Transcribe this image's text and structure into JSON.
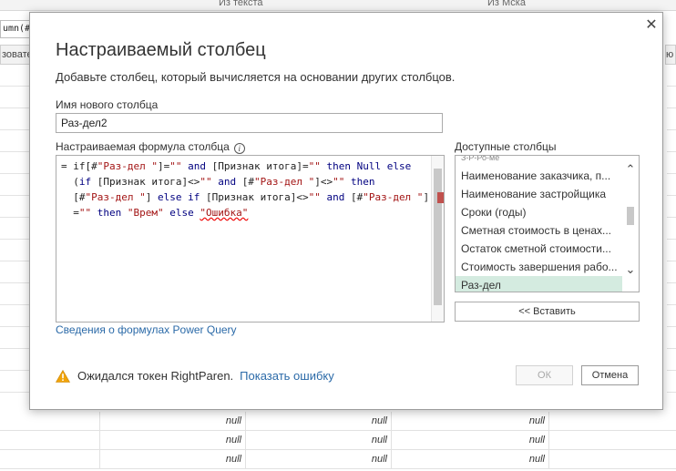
{
  "background": {
    "header_texts": [
      "Из текста",
      "Из Мска"
    ],
    "formula_fragment": "umn(#",
    "left_column_header": "зовате",
    "right_column_header": "ю",
    "null_rows": [
      [
        "null",
        "null",
        "null"
      ],
      [
        "null",
        "null",
        "null"
      ],
      [
        "null",
        "null",
        "null"
      ]
    ]
  },
  "dialog": {
    "close_glyph": "✕",
    "title": "Настраиваемый столбец",
    "subtitle": "Добавьте столбец, который вычисляется на основании других столбцов.",
    "new_column_label": "Имя нового столбца",
    "new_column_value": "Раз-дел2",
    "formula_label": "Настраиваемая формула столбца",
    "formula_info_glyph": "i",
    "formula_lines": [
      [
        {
          "t": "= if[#",
          "c": ""
        },
        {
          "t": "\"Раз-дел \"",
          "c": "str"
        },
        {
          "t": "]=",
          "c": ""
        },
        {
          "t": "\"\"",
          "c": "str"
        },
        {
          "t": " ",
          "c": ""
        },
        {
          "t": "and",
          "c": "kw"
        },
        {
          "t": " [Признак итога]=",
          "c": ""
        },
        {
          "t": "\"\"",
          "c": "str"
        },
        {
          "t": " ",
          "c": ""
        },
        {
          "t": "then",
          "c": "kw"
        },
        {
          "t": " ",
          "c": ""
        },
        {
          "t": "Null",
          "c": "kw"
        },
        {
          "t": " ",
          "c": ""
        },
        {
          "t": "else",
          "c": "kw"
        }
      ],
      [
        {
          "t": "  (",
          "c": ""
        },
        {
          "t": "if",
          "c": "kw"
        },
        {
          "t": " [Признак итога]<>",
          "c": ""
        },
        {
          "t": "\"\"",
          "c": "str"
        },
        {
          "t": " ",
          "c": ""
        },
        {
          "t": "and",
          "c": "kw"
        },
        {
          "t": " [#",
          "c": ""
        },
        {
          "t": "\"Раз-дел \"",
          "c": "str"
        },
        {
          "t": "]<>",
          "c": ""
        },
        {
          "t": "\"\"",
          "c": "str"
        },
        {
          "t": " ",
          "c": ""
        },
        {
          "t": "then",
          "c": "kw"
        }
      ],
      [
        {
          "t": "  [#",
          "c": ""
        },
        {
          "t": "\"Раз-дел \"",
          "c": "str"
        },
        {
          "t": "] ",
          "c": ""
        },
        {
          "t": "else",
          "c": "kw"
        },
        {
          "t": " ",
          "c": ""
        },
        {
          "t": "if",
          "c": "kw"
        },
        {
          "t": " [Признак итога]<>",
          "c": ""
        },
        {
          "t": "\"\"",
          "c": "str"
        },
        {
          "t": " ",
          "c": ""
        },
        {
          "t": "and",
          "c": "kw"
        },
        {
          "t": " [#",
          "c": ""
        },
        {
          "t": "\"Раз-дел \"",
          "c": "str"
        },
        {
          "t": "]",
          "c": ""
        }
      ],
      [
        {
          "t": "  =",
          "c": ""
        },
        {
          "t": "\"\"",
          "c": "str"
        },
        {
          "t": " ",
          "c": ""
        },
        {
          "t": "then",
          "c": "kw"
        },
        {
          "t": " ",
          "c": ""
        },
        {
          "t": "\"Врем\"",
          "c": "str"
        },
        {
          "t": " ",
          "c": ""
        },
        {
          "t": "else",
          "c": "kw"
        },
        {
          "t": " ",
          "c": ""
        },
        {
          "t": "\"Ошибка\"",
          "c": "err-str"
        }
      ]
    ],
    "help_link": "Сведения о формулах Power Query",
    "available_label": "Доступные столбцы",
    "available_partial": "З-Р-Ро-ме",
    "available_columns": [
      "Наименование заказчика, п...",
      "Наименование застройщика",
      "Сроки (годы)",
      "Сметная стоимость в ценах...",
      "Остаток сметной стоимости...",
      "Стоимость завершения рабо...",
      "Раз-дел"
    ],
    "selected_column_index": 6,
    "scroll_up_glyph": "⌃",
    "scroll_down_glyph": "⌄",
    "insert_button": "<< Вставить",
    "status_message": "Ожидался токен RightParen.",
    "show_error_link": "Показать ошибку",
    "ok_button": "ОК",
    "cancel_button": "Отмена",
    "colors": {
      "selection": "#d4ebe0",
      "link": "#2b6aa8",
      "keyword": "#000080",
      "string": "#a31515",
      "warning": "#f0a30a"
    }
  }
}
